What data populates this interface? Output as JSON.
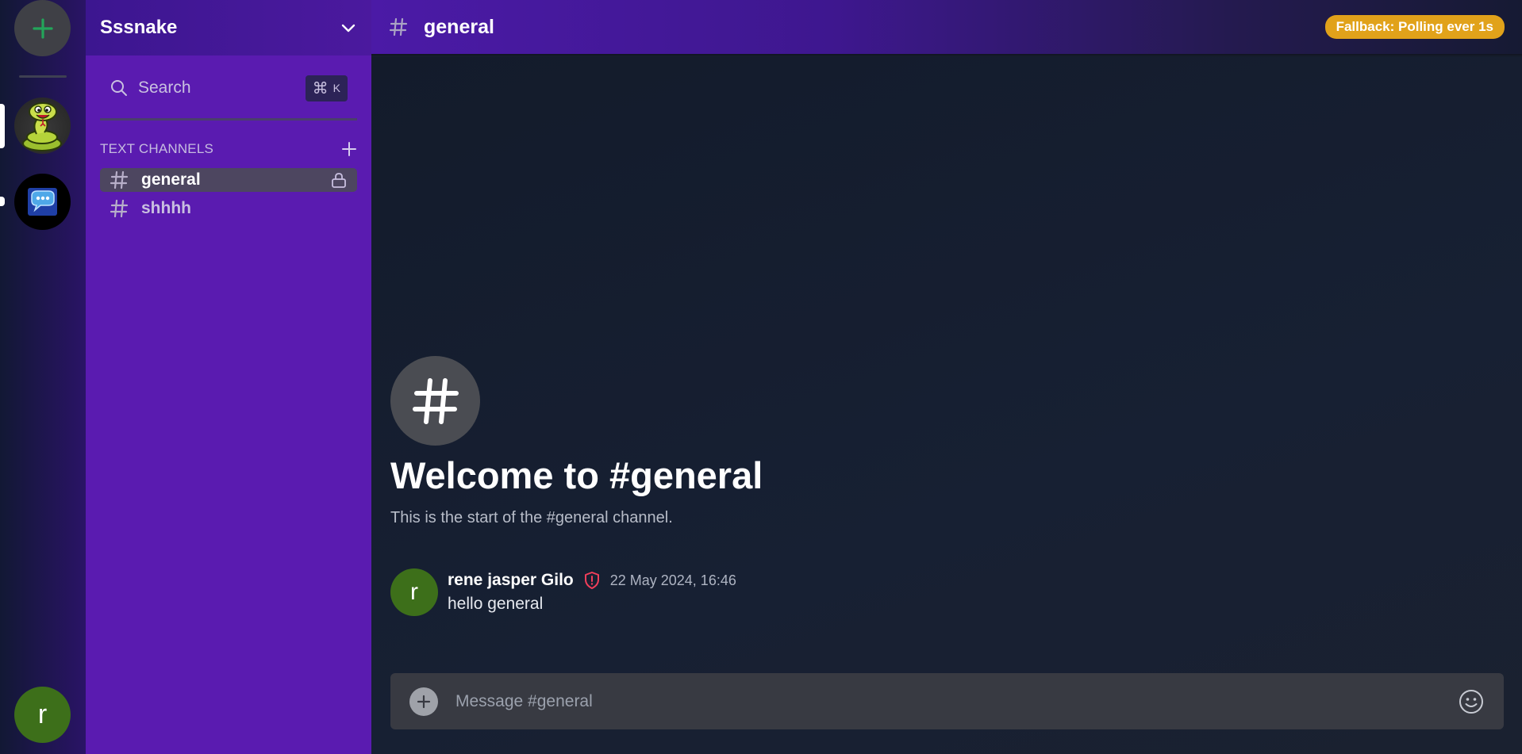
{
  "server": {
    "name": "Sssnake"
  },
  "search": {
    "label": "Search",
    "shortcut_symbol": "⌘",
    "shortcut_key": "K"
  },
  "channels": {
    "section_title": "TEXT CHANNELS",
    "items": [
      {
        "label": "general",
        "active": true,
        "locked": true
      },
      {
        "label": "shhhh",
        "active": false,
        "locked": false
      }
    ]
  },
  "topbar": {
    "channel": "general",
    "status_badge": "Fallback: Polling ever 1s"
  },
  "welcome": {
    "title": "Welcome to #general",
    "subtitle": "This is the start of the #general channel."
  },
  "message": {
    "avatar_letter": "r",
    "author": "rene jasper Gilo",
    "timestamp": "22 May 2024, 16:46",
    "body": "hello general"
  },
  "composer": {
    "placeholder": "Message #general"
  },
  "user": {
    "avatar_letter": "r"
  },
  "colors": {
    "sidebar": "#5a1bb0",
    "badge": "#e1a21a",
    "avatar": "#3d6f1a",
    "add_server_plus": "#23a55a",
    "moderator_shield": "#f23f5a"
  }
}
